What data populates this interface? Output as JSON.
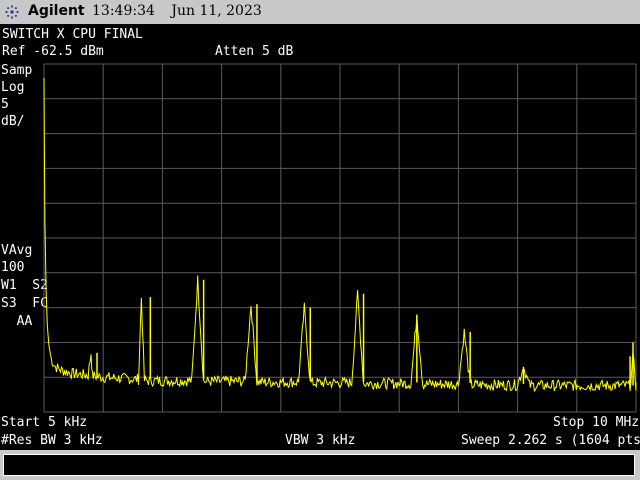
{
  "header": {
    "brand": "Agilent",
    "time": "13:49:34",
    "date": "Jun 11, 2023"
  },
  "screen": {
    "title": "SWITCH X CPU FINAL",
    "ref_level": "Ref -62.5 dBm",
    "attenuation": "Atten 5 dB",
    "left_annotations": [
      "Samp",
      "Log",
      "5",
      "dB/"
    ],
    "left_annotations_lower": [
      "VAvg",
      "100",
      "W1  S2",
      "S3  FC",
      "  AA"
    ],
    "start": "Start 5 kHz",
    "stop": "Stop 10 MHz",
    "rbw": "#Res BW 3 kHz",
    "vbw": "VBW 3 kHz",
    "sweep": "Sweep 2.262 s (1604 pts)"
  },
  "colors": {
    "trace": "#ffff00",
    "grid": "#5a5a5a",
    "background": "#000000",
    "frame": "#c8c8c8"
  },
  "chart_data": {
    "type": "line",
    "xlabel": "",
    "ylabel": "",
    "x_range_hz": [
      5000,
      10000000
    ],
    "y_range_dbm": [
      -112.5,
      -62.5
    ],
    "grid": true,
    "series": [
      {
        "points": [
          [
            5000,
            -64.5
          ],
          [
            20000,
            -85
          ],
          [
            40000,
            -95
          ],
          [
            60000,
            -100
          ],
          [
            90000,
            -103
          ],
          [
            130000,
            -105
          ],
          [
            200000,
            -106
          ],
          [
            300000,
            -106.5
          ],
          [
            500000,
            -107
          ],
          [
            750000,
            -107.2
          ],
          [
            800000,
            -104
          ],
          [
            820000,
            -107.3
          ],
          [
            1000000,
            -107.5
          ],
          [
            1600000,
            -107.8
          ],
          [
            1650000,
            -96
          ],
          [
            1700000,
            -108
          ],
          [
            2500000,
            -108
          ],
          [
            2600000,
            -93.5
          ],
          [
            2700000,
            -108.1
          ],
          [
            3400000,
            -108.1
          ],
          [
            3500000,
            -97
          ],
          [
            3600000,
            -108.2
          ],
          [
            4300000,
            -108.2
          ],
          [
            4400000,
            -97.5
          ],
          [
            4500000,
            -108.3
          ],
          [
            5200000,
            -108.3
          ],
          [
            5300000,
            -95.5
          ],
          [
            5400000,
            -108.4
          ],
          [
            6200000,
            -108.4
          ],
          [
            6300000,
            -98.5
          ],
          [
            6400000,
            -108.5
          ],
          [
            7000000,
            -108.5
          ],
          [
            7100000,
            -101
          ],
          [
            7200000,
            -108.6
          ],
          [
            8000000,
            -108.6
          ],
          [
            8100000,
            -106
          ],
          [
            8200000,
            -108.7
          ],
          [
            9900000,
            -108.7
          ],
          [
            9950000,
            -104.5
          ],
          [
            10000000,
            -108.7
          ],
          [
            10000000,
            -108.7
          ]
        ]
      }
    ],
    "markers_hz_note": "",
    "peaks": [
      {
        "freq_hz": 900000,
        "level_dbm": -104
      },
      {
        "freq_hz": 1800000,
        "level_dbm": -96
      },
      {
        "freq_hz": 2700000,
        "level_dbm": -93.5
      },
      {
        "freq_hz": 3600000,
        "level_dbm": -97
      },
      {
        "freq_hz": 4500000,
        "level_dbm": -97.5
      },
      {
        "freq_hz": 5400000,
        "level_dbm": -95.5
      },
      {
        "freq_hz": 6300000,
        "level_dbm": -98.5
      },
      {
        "freq_hz": 7200000,
        "level_dbm": -101
      },
      {
        "freq_hz": 8100000,
        "level_dbm": -106
      },
      {
        "freq_hz": 9000000,
        "level_dbm": -109
      },
      {
        "freq_hz": 9900000,
        "level_dbm": -104.5
      },
      {
        "freq_hz": 9950000,
        "level_dbm": -102.5
      }
    ]
  }
}
